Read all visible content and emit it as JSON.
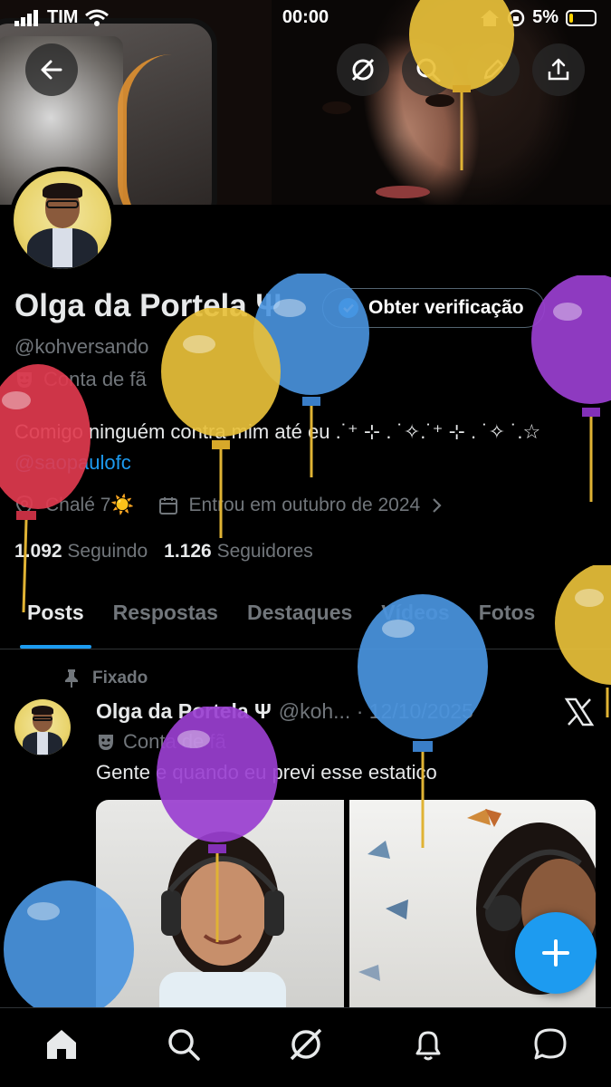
{
  "status_bar": {
    "carrier": "TIM",
    "time": "00:00",
    "battery": "5%"
  },
  "profile": {
    "name": "Olga da Portela Ψ",
    "verify_button": "Obter verificação",
    "handle": "@kohversando",
    "category": "Conta de fã",
    "bio": "Comigo ninguém contra mim até eu .˙⁺ ⊹ . ˙✧.˙⁺ ⊹ . ˙✧ ˙.☆",
    "bio_link": "@saopaulofc",
    "location": "Chalé 7☀️",
    "joined": "Entrou em outubro de 2024",
    "following_count": "1.092",
    "following_label": "Seguindo",
    "followers_count": "1.126",
    "followers_label": "Seguidores"
  },
  "tabs": [
    "Posts",
    "Respostas",
    "Destaques",
    "Vídeos",
    "Fotos"
  ],
  "post": {
    "pinned_label": "Fixado",
    "author": "Olga da Portela Ψ",
    "meta": "@koh... · 12/10/2025",
    "category": "Conta de fã",
    "text": "Gente e quando eu previ esse estatico"
  },
  "icons": {
    "back": "arrow-left-icon",
    "grok": "grok-icon",
    "search": "search-icon",
    "edit": "pencil-icon",
    "share": "share-icon",
    "home": "home-icon",
    "notifications": "bell-icon",
    "messages": "chat-icon",
    "compose": "plus-icon"
  },
  "colors": {
    "accent": "#1d9bf0",
    "muted": "#71767b",
    "background": "#000000"
  }
}
